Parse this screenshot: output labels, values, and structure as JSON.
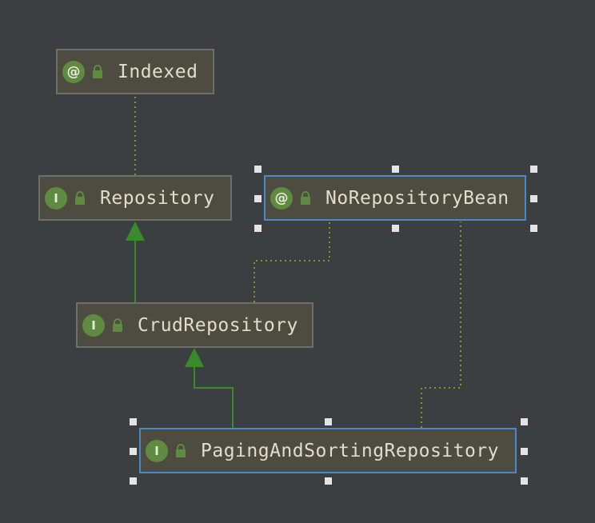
{
  "diagram": {
    "nodes": [
      {
        "id": "indexed",
        "kind": "@",
        "label": "Indexed",
        "selected": false
      },
      {
        "id": "repository",
        "kind": "I",
        "label": "Repository",
        "selected": false
      },
      {
        "id": "norepositorybean",
        "kind": "@",
        "label": "NoRepositoryBean",
        "selected": true
      },
      {
        "id": "crudrepository",
        "kind": "I",
        "label": "CrudRepository",
        "selected": false
      },
      {
        "id": "pagingandsortingrepository",
        "kind": "I",
        "label": "PagingAndSortingRepository",
        "selected": true
      }
    ],
    "edges": [
      {
        "from": "repository",
        "to": "indexed",
        "type": "annotation"
      },
      {
        "from": "crudrepository",
        "to": "repository",
        "type": "extends"
      },
      {
        "from": "crudrepository",
        "to": "norepositorybean",
        "type": "annotation"
      },
      {
        "from": "pagingandsortingrepository",
        "to": "crudrepository",
        "type": "extends"
      },
      {
        "from": "pagingandsortingrepository",
        "to": "norepositorybean",
        "type": "annotation"
      }
    ]
  },
  "colors": {
    "background": "#3c3f41",
    "node_fill": "#4e4b40",
    "node_border": "#6e6e6a",
    "selected_border": "#4a88c7",
    "icon_green": "#5e8b3f",
    "extends_edge": "#3a8a2a",
    "annotation_edge": "#7a9a2a",
    "label_text": "#e1dccb",
    "handle": "#e4e4e4"
  },
  "icons": {
    "annotation_kind": "annotation-icon",
    "interface_kind": "interface-icon",
    "visibility": "unlocked-icon"
  }
}
